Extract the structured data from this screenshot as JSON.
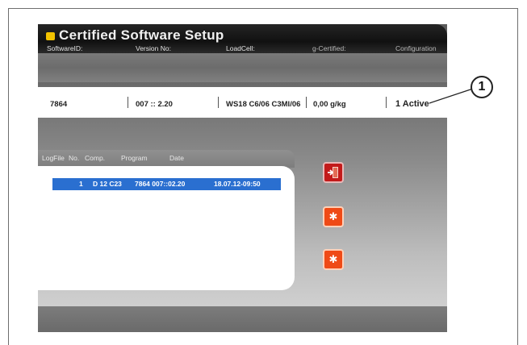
{
  "app": {
    "title": "Certified Software Setup",
    "accent_color": "#f2c200"
  },
  "certified_table": {
    "headers": [
      "SoftwareID:",
      "Version No:",
      "LoadCell:",
      "g-Certified:",
      "Configuration"
    ],
    "row": {
      "software_id": "7864",
      "version_no": "007 :: 2.20",
      "load_cell": "WS18 C6/06 C3MI/06",
      "g_certified": "0,00 g/kg",
      "configuration": "1 Active"
    }
  },
  "logfile": {
    "headers": [
      "LogFile",
      "No.",
      "Comp.",
      "Program",
      "Date"
    ],
    "selected_row": {
      "no": "1",
      "comp": "D  12 C23",
      "program": "7864  007::02.20",
      "date": "18.07.12-09:50"
    },
    "selection_color": "#2a6fd0"
  },
  "buttons": {
    "exit_icon": "door-exit-icon",
    "action1_icon": "asterisk-icon",
    "action2_icon": "asterisk-icon",
    "exit_color": "#c21a1a",
    "action_color": "#ef4a16"
  },
  "callout": {
    "number": "1"
  }
}
